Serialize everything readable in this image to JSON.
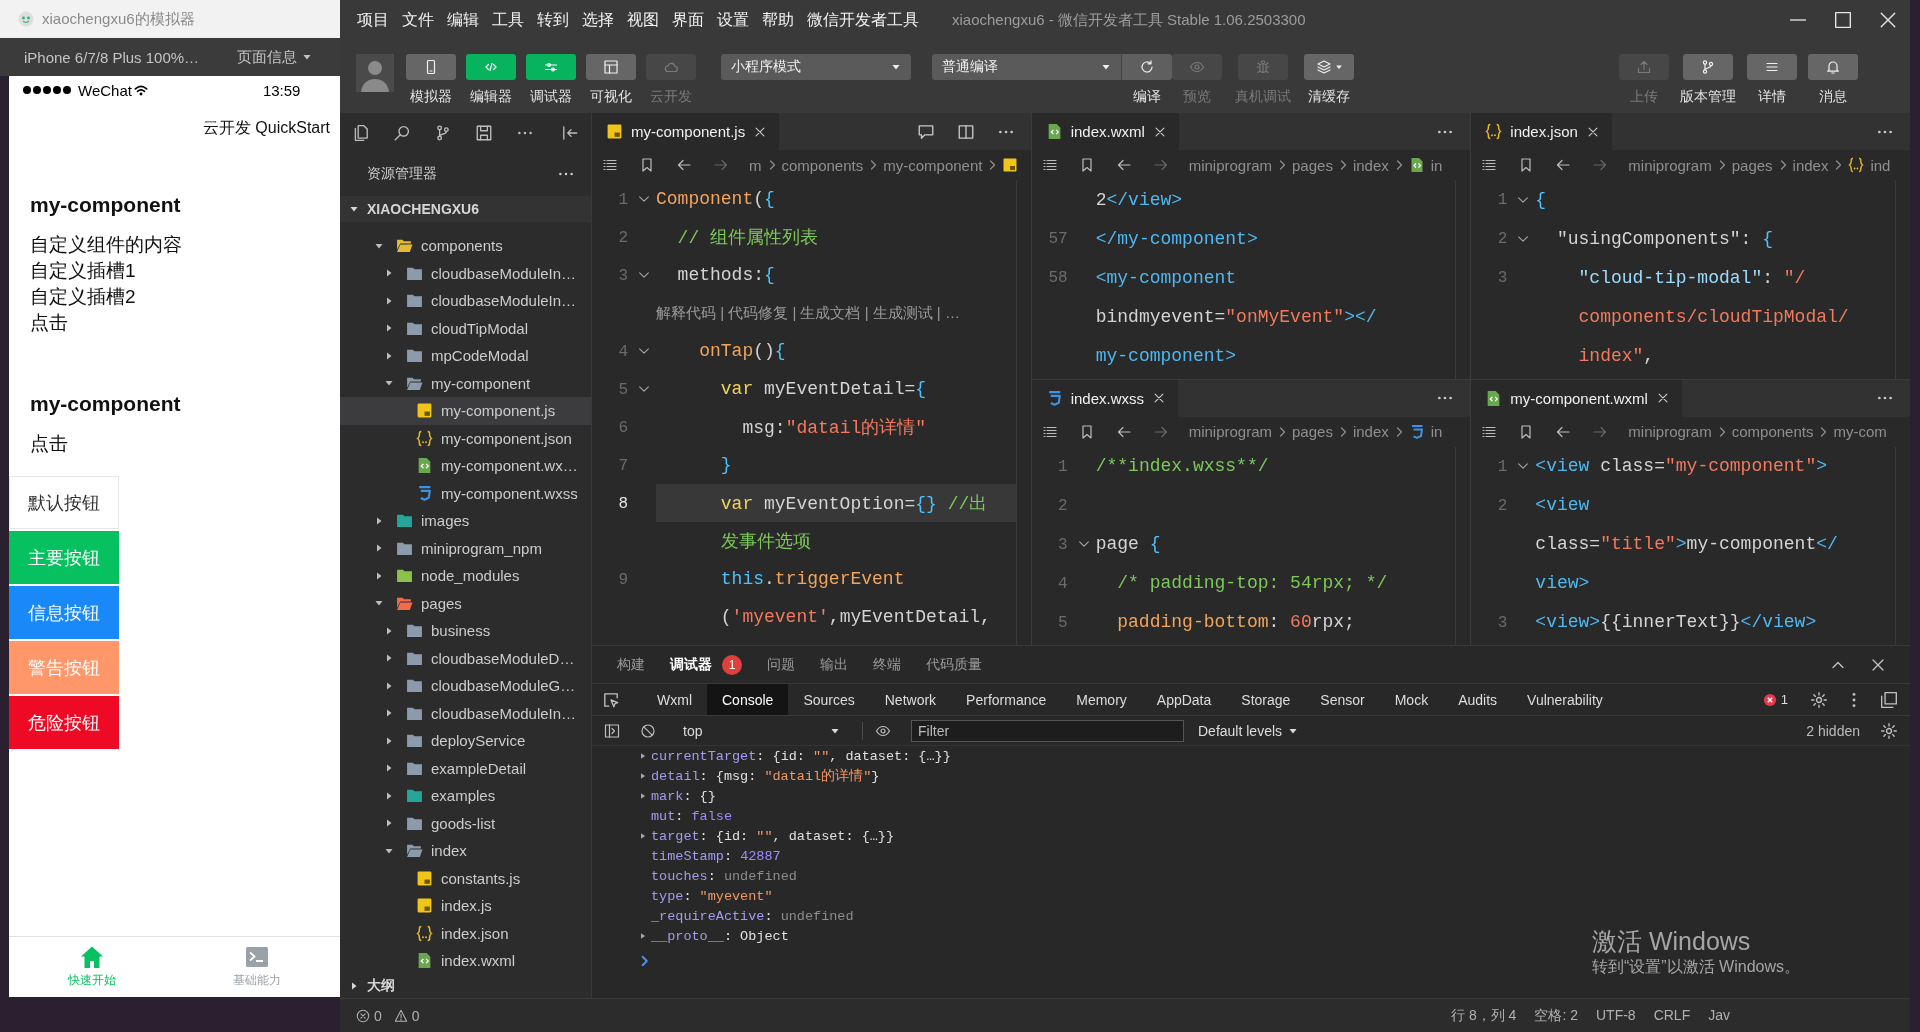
{
  "simulator": {
    "title": "xiaochengxu6的模拟器",
    "device": "iPhone 6/7/8 Plus 100%…",
    "page_info": "页面信息",
    "status_bar": {
      "carrier": "WeChat",
      "time": "13:59"
    },
    "nav_title": "云开发 QuickStart",
    "blocks": [
      {
        "title": "my-component",
        "lines": [
          "自定义组件的内容",
          "自定义插槽1",
          "自定义插槽2",
          "点击"
        ]
      },
      {
        "title": "my-component",
        "lines": [
          "点击"
        ]
      }
    ],
    "buttons": [
      {
        "label": "默认按钮",
        "color": "#ffffff"
      },
      {
        "label": "主要按钮",
        "color": "#07c160"
      },
      {
        "label": "信息按钮",
        "color": "#1989fa"
      },
      {
        "label": "警告按钮",
        "color": "#ff976a"
      },
      {
        "label": "危险按钮",
        "color": "#ee0a24"
      }
    ],
    "tabbar": [
      {
        "label": "快速开始",
        "selected": true
      },
      {
        "label": "基础能力",
        "selected": false
      }
    ]
  },
  "window": {
    "title": "xiaochengxu6 - 微信开发者工具 Stable 1.06.2503300"
  },
  "menu": [
    "项目",
    "文件",
    "编辑",
    "工具",
    "转到",
    "选择",
    "视图",
    "界面",
    "设置",
    "帮助",
    "微信开发者工具"
  ],
  "toolbar": {
    "view_toggles": [
      {
        "label": "模拟器",
        "on": false,
        "disabled": false
      },
      {
        "label": "编辑器",
        "on": true,
        "disabled": false
      },
      {
        "label": "调试器",
        "on": true,
        "disabled": false
      },
      {
        "label": "可视化",
        "on": false,
        "disabled": false
      },
      {
        "label": "云开发",
        "on": false,
        "disabled": true
      }
    ],
    "mode_select": "小程序模式",
    "compile_select": "普通编译",
    "actions": [
      {
        "label": "编译",
        "disabled": false
      },
      {
        "label": "预览",
        "disabled": true
      },
      {
        "label": "真机调试",
        "disabled": true
      },
      {
        "label": "清缓存",
        "disabled": false
      }
    ],
    "right_actions": [
      {
        "label": "上传",
        "disabled": true
      },
      {
        "label": "版本管理",
        "disabled": false
      },
      {
        "label": "详情",
        "disabled": false
      },
      {
        "label": "消息",
        "disabled": false
      }
    ]
  },
  "explorer": {
    "title": "资源管理器",
    "root": "XIAOCHENGXU6",
    "outline": "大纲",
    "tree": [
      {
        "name": "components",
        "kind": "folder",
        "color": "#e2b93b",
        "expanded": true,
        "selected": false,
        "children": [
          {
            "name": "cloudbaseModuleIn…",
            "kind": "folder",
            "color": "#8b9bab",
            "expanded": false,
            "selected": false
          },
          {
            "name": "cloudbaseModuleIn…",
            "kind": "folder",
            "color": "#8b9bab",
            "expanded": false,
            "selected": false
          },
          {
            "name": "cloudTipModal",
            "kind": "folder",
            "color": "#8b9bab",
            "expanded": false,
            "selected": false
          },
          {
            "name": "mpCodeModal",
            "kind": "folder",
            "color": "#8b9bab",
            "expanded": false,
            "selected": false
          },
          {
            "name": "my-component",
            "kind": "folder",
            "color": "#8b9bab",
            "expanded": true,
            "selected": false,
            "children": [
              {
                "name": "my-component.js",
                "kind": "js",
                "selected": true
              },
              {
                "name": "my-component.json",
                "kind": "json",
                "selected": false
              },
              {
                "name": "my-component.wx…",
                "kind": "wxml",
                "selected": false
              },
              {
                "name": "my-component.wxss",
                "kind": "wxss",
                "selected": false
              }
            ]
          }
        ]
      },
      {
        "name": "images",
        "kind": "folder",
        "color": "#26a69a",
        "expanded": false,
        "selected": false
      },
      {
        "name": "miniprogram_npm",
        "kind": "folder",
        "color": "#8b9bab",
        "expanded": false,
        "selected": false
      },
      {
        "name": "node_modules",
        "kind": "folder",
        "color": "#8bc34a",
        "expanded": false,
        "selected": false
      },
      {
        "name": "pages",
        "kind": "folder",
        "color": "#f26b4a",
        "expanded": true,
        "selected": false,
        "children": [
          {
            "name": "business",
            "kind": "folder",
            "color": "#8b9bab",
            "expanded": false,
            "selected": false
          },
          {
            "name": "cloudbaseModuleD…",
            "kind": "folder",
            "color": "#8b9bab",
            "expanded": false,
            "selected": false
          },
          {
            "name": "cloudbaseModuleG…",
            "kind": "folder",
            "color": "#8b9bab",
            "expanded": false,
            "selected": false
          },
          {
            "name": "cloudbaseModuleIn…",
            "kind": "folder",
            "color": "#8b9bab",
            "expanded": false,
            "selected": false
          },
          {
            "name": "deployService",
            "kind": "folder",
            "color": "#8b9bab",
            "expanded": false,
            "selected": false
          },
          {
            "name": "exampleDetail",
            "kind": "folder",
            "color": "#8b9bab",
            "expanded": false,
            "selected": false
          },
          {
            "name": "examples",
            "kind": "folder",
            "color": "#26a69a",
            "expanded": false,
            "selected": false
          },
          {
            "name": "goods-list",
            "kind": "folder",
            "color": "#8b9bab",
            "expanded": false,
            "selected": false
          },
          {
            "name": "index",
            "kind": "folder",
            "color": "#8b9bab",
            "expanded": true,
            "selected": false,
            "children": [
              {
                "name": "constants.js",
                "kind": "js",
                "selected": false
              },
              {
                "name": "index.js",
                "kind": "js",
                "selected": false
              },
              {
                "name": "index.json",
                "kind": "json",
                "selected": false
              },
              {
                "name": "index.wxml",
                "kind": "wxml",
                "selected": false
              }
            ]
          }
        ]
      }
    ]
  },
  "editor_columns": [
    {
      "groups": [
        {
          "active": true,
          "tab": {
            "name": "my-component.js",
            "kind": "js",
            "selected": true
          },
          "breadcrumb": [
            "m",
            "components",
            "my-component"
          ],
          "breadcrumb_file": {
            "kind": "js"
          },
          "lines": [
            {
              "kind": "code",
              "num": "1",
              "fold": true,
              "current": false,
              "tokens": [
                {
                  "text": "Component",
                  "kind": "fn"
                },
                {
                  "text": "(",
                  "kind": "plain"
                },
                {
                  "text": "{",
                  "kind": "brace"
                }
              ]
            },
            {
              "kind": "code",
              "num": "2",
              "fold": false,
              "current": false,
              "tokens": [
                {
                  "text": "  // 组件属性列表",
                  "kind": "comment"
                }
              ]
            },
            {
              "kind": "code",
              "num": "3",
              "fold": true,
              "current": false,
              "tokens": [
                {
                  "text": "  methods:",
                  "kind": "plain"
                },
                {
                  "text": "{",
                  "kind": "brace"
                }
              ]
            },
            {
              "kind": "codelens",
              "current": false,
              "text": "解释代码 | 代码修复 | 生成文档 | 生成测试 | …"
            },
            {
              "kind": "code",
              "num": "4",
              "fold": true,
              "current": false,
              "tokens": [
                {
                  "text": "    onTap",
                  "kind": "fn"
                },
                {
                  "text": "()",
                  "kind": "plain"
                },
                {
                  "text": "{",
                  "kind": "brace"
                }
              ]
            },
            {
              "kind": "code",
              "num": "5",
              "fold": true,
              "current": false,
              "tokens": [
                {
                  "text": "      var",
                  "kind": "keyword"
                },
                {
                  "text": " myEventDetail=",
                  "kind": "plain"
                },
                {
                  "text": "{",
                  "kind": "brace"
                }
              ]
            },
            {
              "kind": "code",
              "num": "6",
              "fold": false,
              "current": false,
              "tokens": [
                {
                  "text": "        msg:",
                  "kind": "plain"
                },
                {
                  "text": "\"datail的详情\"",
                  "kind": "string"
                }
              ]
            },
            {
              "kind": "code",
              "num": "7",
              "fold": false,
              "current": false,
              "tokens": [
                {
                  "text": "      }",
                  "kind": "brace"
                }
              ]
            },
            {
              "kind": "code",
              "num": "8",
              "fold": false,
              "current": true,
              "tokens": [
                {
                  "text": "      var",
                  "kind": "keyword"
                },
                {
                  "text": " myEventOption=",
                  "kind": "plain"
                },
                {
                  "text": "{}",
                  "kind": "brace"
                },
                {
                  "text": " //出",
                  "kind": "comment"
                }
              ]
            },
            {
              "kind": "code",
              "fold": false,
              "current": false,
              "tokens": [
                {
                  "text": "      发事件选项",
                  "kind": "comment"
                }
              ]
            },
            {
              "kind": "code",
              "num": "9",
              "fold": false,
              "current": false,
              "tokens": [
                {
                  "text": "      this",
                  "kind": "this"
                },
                {
                  "text": ".",
                  "kind": "plain"
                },
                {
                  "text": "triggerEvent",
                  "kind": "fn"
                }
              ]
            },
            {
              "kind": "code",
              "fold": false,
              "current": false,
              "tokens": [
                {
                  "text": "      (",
                  "kind": "plain"
                },
                {
                  "text": "'myevent'",
                  "kind": "string"
                },
                {
                  "text": ",myEventDetail,",
                  "kind": "plain"
                }
              ]
            }
          ]
        }
      ]
    },
    {
      "groups": [
        {
          "active": false,
          "tab": {
            "name": "index.wxml",
            "kind": "wxml",
            "selected": true
          },
          "breadcrumb": [
            "miniprogram",
            "pages",
            "index"
          ],
          "breadcrumb_file": {
            "kind": "wxml",
            "text": "in"
          },
          "lines": [
            {
              "fold": false,
              "tokens": [
                {
                  "text": "2",
                  "kind": "plain"
                },
                {
                  "text": "</view>",
                  "kind": "tag"
                }
              ]
            },
            {
              "num": "57",
              "fold": false,
              "tokens": [
                {
                  "text": "</my-component>",
                  "kind": "tag"
                }
              ]
            },
            {
              "num": "58",
              "fold": false,
              "tokens": [
                {
                  "text": "<my-component",
                  "kind": "tag"
                }
              ]
            },
            {
              "fold": false,
              "tokens": [
                {
                  "text": "bindmyevent=",
                  "kind": "plain"
                },
                {
                  "text": "\"onMyEvent\"",
                  "kind": "string"
                },
                {
                  "text": "></",
                  "kind": "tag"
                }
              ]
            },
            {
              "fold": false,
              "tokens": [
                {
                  "text": "my-component>",
                  "kind": "tag"
                }
              ]
            }
          ]
        },
        {
          "active": false,
          "tab": {
            "name": "index.wxss",
            "kind": "wxss",
            "selected": true
          },
          "breadcrumb": [
            "miniprogram",
            "pages",
            "index"
          ],
          "breadcrumb_file": {
            "kind": "wxss",
            "text": "in"
          },
          "lines": [
            {
              "num": "1",
              "fold": false,
              "tokens": [
                {
                  "text": "/**index.wxss**/",
                  "kind": "comment"
                }
              ]
            },
            {
              "num": "2",
              "fold": false
            },
            {
              "num": "3",
              "fold": true,
              "tokens": [
                {
                  "text": "page ",
                  "kind": "plain"
                },
                {
                  "text": "{",
                  "kind": "brace"
                }
              ]
            },
            {
              "num": "4",
              "fold": false,
              "tokens": [
                {
                  "text": "  /* padding-top: 54rpx; */",
                  "kind": "comment"
                }
              ]
            },
            {
              "num": "5",
              "fold": false,
              "tokens": [
                {
                  "text": "  padding-bottom",
                  "kind": "fn"
                },
                {
                  "text": ": ",
                  "kind": "plain"
                },
                {
                  "text": "60",
                  "kind": "string"
                },
                {
                  "text": "rpx;",
                  "kind": "plain"
                }
              ]
            }
          ]
        }
      ]
    },
    {
      "groups": [
        {
          "active": false,
          "tab": {
            "name": "index.json",
            "kind": "json",
            "selected": true
          },
          "breadcrumb": [
            "miniprogram",
            "pages",
            "index"
          ],
          "breadcrumb_file": {
            "kind": "json",
            "text": "ind"
          },
          "lines": [
            {
              "num": "1",
              "fold": true,
              "tokens": [
                {
                  "text": "{",
                  "kind": "brace"
                }
              ]
            },
            {
              "num": "2",
              "fold": true,
              "tokens": [
                {
                  "text": "  \"usingComponents\": ",
                  "kind": "plain"
                },
                {
                  "text": "{",
                  "kind": "brace"
                }
              ]
            },
            {
              "num": "3",
              "fold": false,
              "tokens": [
                {
                  "text": "    \"cloud-tip-modal\"",
                  "kind": "key"
                },
                {
                  "text": ": ",
                  "kind": "plain"
                },
                {
                  "text": "\"/",
                  "kind": "string"
                }
              ]
            },
            {
              "fold": false,
              "tokens": [
                {
                  "text": "    components/cloudTipModal/",
                  "kind": "string"
                }
              ]
            },
            {
              "fold": false,
              "tokens": [
                {
                  "text": "    index\"",
                  "kind": "string"
                },
                {
                  "text": ",",
                  "kind": "plain"
                }
              ]
            }
          ]
        },
        {
          "active": false,
          "tab": {
            "name": "my-component.wxml",
            "kind": "wxml",
            "selected": true
          },
          "breadcrumb": [
            "miniprogram",
            "components",
            "my-com"
          ],
          "lines": [
            {
              "num": "1",
              "fold": true,
              "tokens": [
                {
                  "text": "<view",
                  "kind": "tag"
                },
                {
                  "text": " class=",
                  "kind": "plain"
                },
                {
                  "text": "\"my-component\"",
                  "kind": "string"
                },
                {
                  "text": ">",
                  "kind": "tag"
                }
              ]
            },
            {
              "num": "2",
              "fold": false,
              "tokens": [
                {
                  "text": "<view",
                  "kind": "tag"
                }
              ]
            },
            {
              "fold": false,
              "tokens": [
                {
                  "text": "class=",
                  "kind": "plain"
                },
                {
                  "text": "\"title\"",
                  "kind": "string"
                },
                {
                  "text": ">",
                  "kind": "tag"
                },
                {
                  "text": "my-component",
                  "kind": "plain"
                },
                {
                  "text": "</",
                  "kind": "tag"
                }
              ]
            },
            {
              "fold": false,
              "tokens": [
                {
                  "text": "view>",
                  "kind": "tag"
                }
              ]
            },
            {
              "num": "3",
              "fold": false,
              "tokens": [
                {
                  "text": "<view>",
                  "kind": "tag"
                },
                {
                  "text": "{{innerText}}",
                  "kind": "plain"
                },
                {
                  "text": "</view>",
                  "kind": "tag"
                }
              ]
            }
          ]
        }
      ]
    }
  ],
  "panel": {
    "tabs": [
      {
        "label": "构建",
        "selected": false
      },
      {
        "label": "调试器",
        "selected": true,
        "badge": "1"
      },
      {
        "label": "问题",
        "selected": false
      },
      {
        "label": "输出",
        "selected": false
      },
      {
        "label": "终端",
        "selected": false
      },
      {
        "label": "代码质量",
        "selected": false
      }
    ]
  },
  "devtools": {
    "tabs": [
      {
        "label": "Wxml",
        "selected": false
      },
      {
        "label": "Console",
        "selected": true
      },
      {
        "label": "Sources",
        "selected": false
      },
      {
        "label": "Network",
        "selected": false
      },
      {
        "label": "Performance",
        "selected": false
      },
      {
        "label": "Memory",
        "selected": false
      },
      {
        "label": "AppData",
        "selected": false
      },
      {
        "label": "Storage",
        "selected": false
      },
      {
        "label": "Sensor",
        "selected": false
      },
      {
        "label": "Mock",
        "selected": false
      },
      {
        "label": "Audits",
        "selected": false
      },
      {
        "label": "Vulnerability",
        "selected": false
      }
    ],
    "error_count": "1",
    "context": "top",
    "filter_placeholder": "Filter",
    "levels": "Default levels",
    "hidden": "2 hidden",
    "console": [
      {
        "key": "currentTarget",
        "expandable": true,
        "value": [
          {
            "text": ": {id: ",
            "kind": "plain"
          },
          {
            "text": "\"\"",
            "kind": "string"
          },
          {
            "text": ", dataset: {…}}",
            "kind": "plain"
          }
        ]
      },
      {
        "key": "detail",
        "expandable": true,
        "value": [
          {
            "text": ": {msg: ",
            "kind": "plain"
          },
          {
            "text": "\"datail的详情\"",
            "kind": "string"
          },
          {
            "text": "}",
            "kind": "plain"
          }
        ]
      },
      {
        "key": "mark",
        "expandable": true,
        "value": [
          {
            "text": ": {}",
            "kind": "plain"
          }
        ]
      },
      {
        "key": "mut",
        "expandable": false,
        "value": [
          {
            "text": ": ",
            "kind": "plain"
          },
          {
            "text": "false",
            "kind": "keyword"
          }
        ]
      },
      {
        "key": "target",
        "expandable": true,
        "value": [
          {
            "text": ": {id: ",
            "kind": "plain"
          },
          {
            "text": "\"\"",
            "kind": "string"
          },
          {
            "text": ", dataset: {…}}",
            "kind": "plain"
          }
        ]
      },
      {
        "key": "timeStamp",
        "expandable": false,
        "value": [
          {
            "text": ": ",
            "kind": "plain"
          },
          {
            "text": "42887",
            "kind": "number"
          }
        ]
      },
      {
        "key": "touches",
        "expandable": false,
        "value": [
          {
            "text": ": ",
            "kind": "plain"
          },
          {
            "text": "undefined",
            "kind": "undefined"
          }
        ]
      },
      {
        "key": "type",
        "expandable": false,
        "value": [
          {
            "text": ": ",
            "kind": "plain"
          },
          {
            "text": "\"myevent\"",
            "kind": "string"
          }
        ]
      },
      {
        "key": "_requireActive",
        "expandable": false,
        "value": [
          {
            "text": ": ",
            "kind": "plain"
          },
          {
            "text": "undefined",
            "kind": "undefined"
          }
        ]
      },
      {
        "key": "__proto__",
        "expandable": true,
        "value": [
          {
            "text": ": Object",
            "kind": "plain"
          }
        ]
      }
    ]
  },
  "status_bar": {
    "errors": "0",
    "warnings": "0",
    "items": [
      "行 8，列 4",
      "空格: 2",
      "UTF-8",
      "CRLF",
      "Jav"
    ]
  },
  "os_notice": {
    "title": "激活 Windows",
    "text": "转到“设置”以激活 Windows。"
  }
}
